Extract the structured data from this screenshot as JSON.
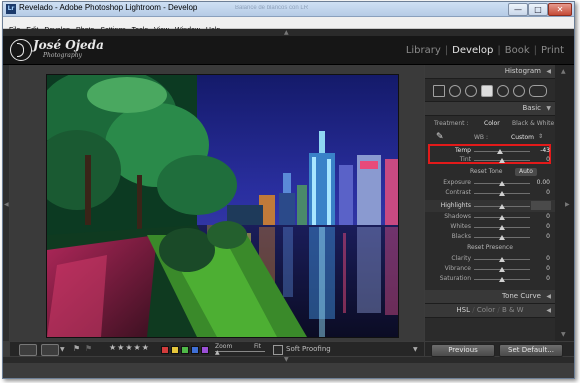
{
  "window": {
    "title": "Revelado - Adobe Photoshop Lightroom - Develop",
    "ghost_text": "Balance de blancos con LR",
    "controls": {
      "minimize": "—",
      "maximize": "□",
      "close": "✕"
    }
  },
  "menu": [
    "File",
    "Edit",
    "Develop",
    "Photo",
    "Settings",
    "Tools",
    "View",
    "Window",
    "Help"
  ],
  "identity": {
    "name": "José Ojeda",
    "tagline": "Photography"
  },
  "modules": {
    "items": [
      "Library",
      "Develop",
      "Book",
      "Print"
    ],
    "active": "Develop"
  },
  "panels": {
    "histogram": {
      "title": "Histogram"
    },
    "basic": {
      "title": "Basic",
      "treatment_label": "Treatment :",
      "treatment_color": "Color",
      "treatment_bw": "Black & White",
      "wb_label": "WB :",
      "wb_value": "Custom",
      "temp": {
        "label": "Temp",
        "value": "-43",
        "level": 0.47
      },
      "tint": {
        "label": "Tint",
        "value": "0",
        "level": 0.5
      },
      "reset_tone": "Reset Tone",
      "auto": "Auto",
      "tone": [
        {
          "label": "Exposure",
          "value": "0.00",
          "level": 0.5
        },
        {
          "label": "Contrast",
          "value": "0",
          "level": 0.5
        }
      ],
      "highlights": {
        "label": "Highlights",
        "value": "0",
        "level": 0.5
      },
      "lights": [
        {
          "label": "Shadows",
          "value": "0",
          "level": 0.5
        },
        {
          "label": "Whites",
          "value": "0",
          "level": 0.5
        },
        {
          "label": "Blacks",
          "value": "0",
          "level": 0.5
        }
      ],
      "reset_presence": "Reset Presence",
      "presence": [
        {
          "label": "Clarity",
          "value": "0",
          "level": 0.5
        },
        {
          "label": "Vibrance",
          "value": "0",
          "level": 0.5
        },
        {
          "label": "Saturation",
          "value": "0",
          "level": 0.5
        }
      ]
    },
    "tone_curve": {
      "title": "Tone Curve"
    },
    "hsl": {
      "hsl": "HSL",
      "color": "Color",
      "bw": "B & W"
    }
  },
  "bottom": {
    "zoom_label": "Zoom",
    "fit_label": "Fit",
    "soft_proofing": "Soft Proofing",
    "stars": "★★★★★",
    "previous": "Previous",
    "set_default": "Set Default..."
  },
  "colors": {
    "accent_red": "#e21a1a",
    "chips": [
      "#d23c3c",
      "#e5c53a",
      "#4fb848",
      "#3f6fd6",
      "#9a4fd6"
    ]
  }
}
